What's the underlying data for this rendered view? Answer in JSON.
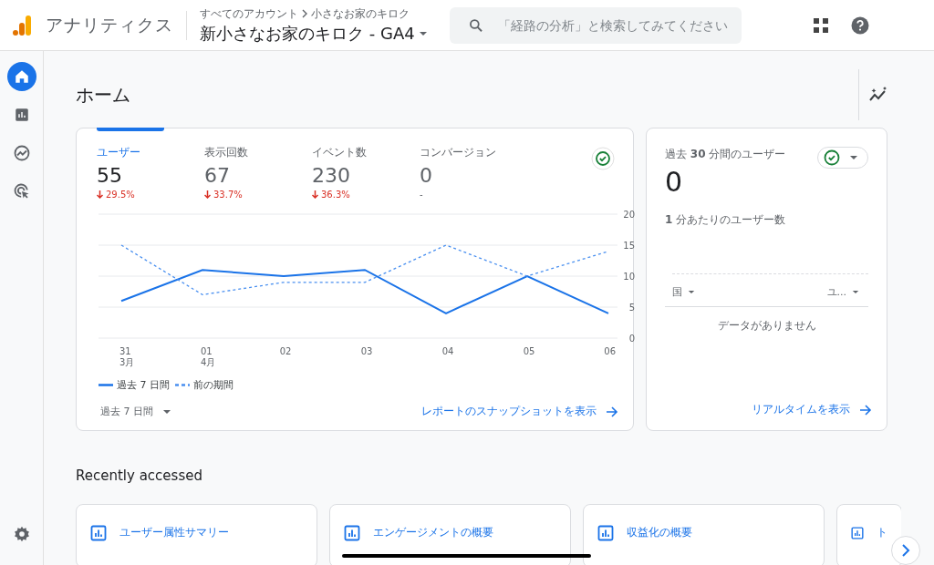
{
  "app": {
    "name": "アナリティクス",
    "breadcrumb": [
      "すべてのアカウント",
      "小さなお家のキロク"
    ],
    "property": "新小さなお家のキロク - GA4"
  },
  "search": {
    "placeholder": "「経路の分析」と検索してみてください"
  },
  "sidebar": {
    "items": [
      {
        "kind": "home",
        "selected": true
      },
      {
        "kind": "reports",
        "selected": false
      },
      {
        "kind": "explore",
        "selected": false
      },
      {
        "kind": "advertising",
        "selected": false
      }
    ]
  },
  "page_title": "ホーム",
  "overview": {
    "metrics": [
      {
        "label": "ユーザー",
        "value": "55",
        "change": "29.5%",
        "declined": true,
        "selected": true
      },
      {
        "label": "表示回数",
        "value": "67",
        "change": "33.7%",
        "declined": true,
        "selected": false
      },
      {
        "label": "イベント数",
        "value": "230",
        "change": "36.3%",
        "declined": true,
        "selected": false
      },
      {
        "label": "コンバージョン",
        "value": "0",
        "change": "-",
        "declined": false,
        "selected": false
      }
    ],
    "chart_data": {
      "type": "line",
      "categories": [
        "31\n3月",
        "01\n4月",
        "02",
        "03",
        "04",
        "05",
        "06"
      ],
      "ylim": [
        0,
        20
      ],
      "grid": true,
      "yticks": [
        0,
        5,
        10,
        15,
        20
      ],
      "series": [
        {
          "name": "過去 7 日間",
          "color": "#1a73e8",
          "line_style": "solid",
          "values": [
            6,
            11,
            10,
            11,
            4,
            10,
            4
          ]
        },
        {
          "name": "前の期間",
          "color": "#4a90f0",
          "line_style": "dashed",
          "values": [
            15,
            7,
            9,
            9,
            15,
            10,
            14
          ]
        }
      ]
    },
    "date_range": "過去 7 日間",
    "link": "レポートのスナップショットを表示"
  },
  "realtime": {
    "title": "過去 **30** 分間のユーザー",
    "value": "0",
    "subtitle": "**1** 分あたりのユーザー数",
    "columns": [
      "国",
      "ユ..."
    ],
    "empty": "データがありません",
    "link": "リアルタイムを表示"
  },
  "recent": {
    "title": "Recently accessed",
    "items": [
      "ユーザー属性サマリー",
      "エンゲージメントの概要",
      "収益化の概要",
      "ト"
    ]
  }
}
